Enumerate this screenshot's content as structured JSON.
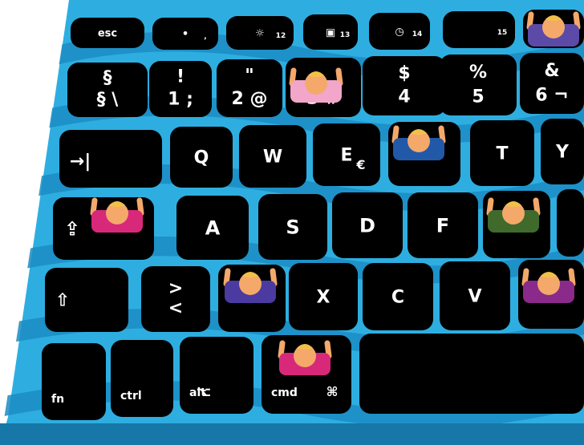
{
  "colors": {
    "keyboard_body": "#2eaee0",
    "keyboard_stripe": "#1b8cc4",
    "keyboard_edge": "#1677a8",
    "key": "#000000",
    "legend": "#ffffff",
    "skin": "#f4a96a",
    "hair": "#f2c04a"
  },
  "rows": [
    {
      "id": "fn-row",
      "keys": [
        {
          "name": "esc",
          "primary": "esc",
          "secondary": ""
        },
        {
          "name": "f1",
          "primary": "•",
          "secondary": ","
        },
        {
          "name": "f2",
          "primary": "☼",
          "secondary": "12"
        },
        {
          "name": "f3",
          "primary": "▣",
          "secondary": "13"
        },
        {
          "name": "f4",
          "primary": "◷",
          "secondary": "14"
        },
        {
          "name": "f5",
          "primary": "",
          "secondary": "15"
        },
        {
          "name": "f6",
          "primary": "",
          "secondary": ""
        }
      ]
    },
    {
      "id": "number-row",
      "keys": [
        {
          "name": "section",
          "primary": "§",
          "secondary": "§ \\"
        },
        {
          "name": "1",
          "primary": "!",
          "secondary": "1 ;"
        },
        {
          "name": "2",
          "primary": "\"",
          "secondary": "2 @"
        },
        {
          "name": "3",
          "primary": "",
          "secondary": "3 #"
        },
        {
          "name": "4",
          "primary": "$",
          "secondary": "4"
        },
        {
          "name": "5",
          "primary": "%",
          "secondary": "5"
        },
        {
          "name": "6",
          "primary": "&",
          "secondary": "6 ¬"
        }
      ]
    },
    {
      "id": "top-letter-row",
      "keys": [
        {
          "name": "tab",
          "primary": "→|",
          "secondary": ""
        },
        {
          "name": "q",
          "primary": "Q",
          "secondary": ""
        },
        {
          "name": "w",
          "primary": "W",
          "secondary": ""
        },
        {
          "name": "e",
          "primary": "E",
          "secondary": "€"
        },
        {
          "name": "r",
          "primary": "",
          "secondary": ""
        },
        {
          "name": "t",
          "primary": "T",
          "secondary": ""
        },
        {
          "name": "y",
          "primary": "Y",
          "secondary": ""
        }
      ]
    },
    {
      "id": "home-row",
      "keys": [
        {
          "name": "caps",
          "primary": "⇪",
          "secondary": ""
        },
        {
          "name": "a",
          "primary": "A",
          "secondary": ""
        },
        {
          "name": "s",
          "primary": "S",
          "secondary": ""
        },
        {
          "name": "d",
          "primary": "D",
          "secondary": ""
        },
        {
          "name": "f",
          "primary": "F",
          "secondary": ""
        },
        {
          "name": "g",
          "primary": "",
          "secondary": ""
        },
        {
          "name": "h",
          "primary": "",
          "secondary": ""
        }
      ]
    },
    {
      "id": "bottom-letter-row",
      "keys": [
        {
          "name": "shift",
          "primary": "⇧",
          "secondary": ""
        },
        {
          "name": "angle",
          "primary": ">",
          "secondary": "<"
        },
        {
          "name": "z",
          "primary": "",
          "secondary": ""
        },
        {
          "name": "x",
          "primary": "X",
          "secondary": ""
        },
        {
          "name": "c",
          "primary": "C",
          "secondary": ""
        },
        {
          "name": "v",
          "primary": "V",
          "secondary": ""
        },
        {
          "name": "b",
          "primary": "",
          "secondary": ""
        }
      ]
    },
    {
      "id": "modifier-row",
      "keys": [
        {
          "name": "fn",
          "primary": "fn",
          "secondary": ""
        },
        {
          "name": "ctrl",
          "primary": "ctrl",
          "secondary": ""
        },
        {
          "name": "alt",
          "primary": "alt",
          "secondary": "⌥"
        },
        {
          "name": "cmd",
          "primary": "cmd",
          "secondary": "⌘"
        },
        {
          "name": "space",
          "primary": "",
          "secondary": ""
        }
      ]
    }
  ],
  "figures": [
    {
      "name": "figure-pink-top",
      "shirt": "#5c4aa8"
    },
    {
      "name": "figure-light-pink",
      "shirt": "#f2a6c9"
    },
    {
      "name": "figure-blue",
      "shirt": "#2159a8"
    },
    {
      "name": "figure-magenta-left",
      "shirt": "#d8287a"
    },
    {
      "name": "figure-green",
      "shirt": "#3f6a2c"
    },
    {
      "name": "figure-purple-left",
      "shirt": "#4b3aa0"
    },
    {
      "name": "figure-purple-right",
      "shirt": "#8a2a8a"
    },
    {
      "name": "figure-magenta-bottom",
      "shirt": "#d8287a"
    }
  ]
}
